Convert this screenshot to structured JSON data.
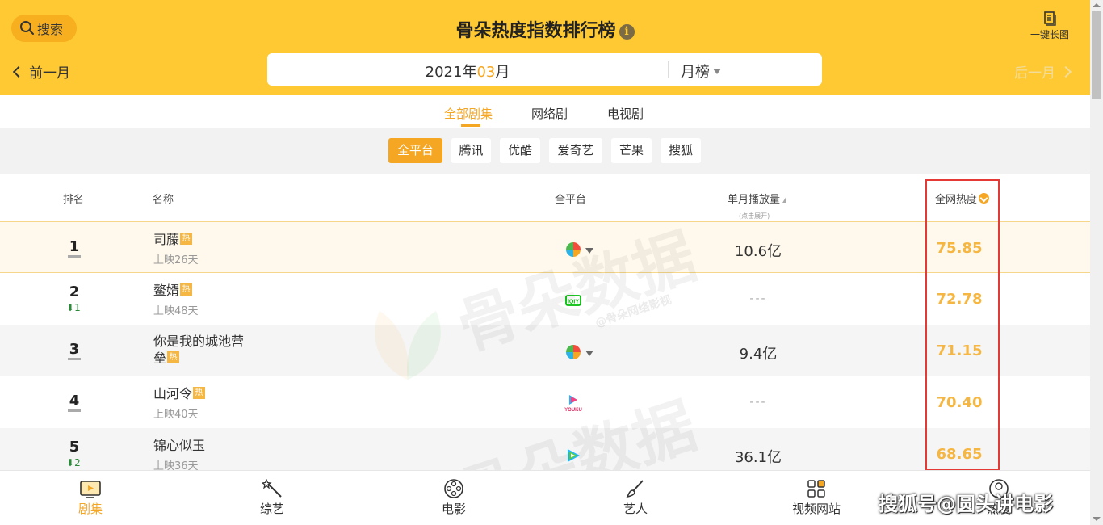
{
  "header": {
    "search_label": "搜索",
    "title": "骨朵热度指数排行榜",
    "info_icon": "i",
    "long_image_label": "一键长图",
    "prev_month_label": "前一月",
    "next_month_label": "后一月",
    "date_year": "2021年",
    "date_month": "03",
    "date_month_suffix": "月",
    "rank_type": "月榜"
  },
  "category_tabs": [
    "全部剧集",
    "网络剧",
    "电视剧"
  ],
  "platform_tabs": [
    "全平台",
    "腾讯",
    "优酷",
    "爱奇艺",
    "芒果",
    "搜狐"
  ],
  "table": {
    "columns": {
      "rank": "排名",
      "name": "名称",
      "platform": "全平台",
      "plays": "单月播放量",
      "plays_hint": "(点击展开)",
      "heat": "全网热度"
    },
    "hot_tag": "热",
    "rows": [
      {
        "rank": "1",
        "change": "",
        "name": "司藤",
        "name_line2": "",
        "sub": "上映26天",
        "platform_icon": "multi-platform-icon",
        "plays": "10.6亿",
        "heat": "75.85"
      },
      {
        "rank": "2",
        "change": "1",
        "name": "鳌婿",
        "name_line2": "",
        "sub": "上映48天",
        "platform_icon": "iqiyi-icon",
        "plays": "---",
        "heat": "72.78"
      },
      {
        "rank": "3",
        "change": "",
        "name": "你是我的城池营",
        "name_line2": "垒",
        "sub": "",
        "platform_icon": "multi-platform-icon",
        "plays": "9.4亿",
        "heat": "71.15"
      },
      {
        "rank": "4",
        "change": "",
        "name": "山河令",
        "name_line2": "",
        "sub": "上映40天",
        "platform_icon": "youku-icon",
        "plays": "---",
        "heat": "70.40"
      },
      {
        "rank": "5",
        "change": "2",
        "name": "锦心似玉",
        "name_line2": "",
        "sub": "上映36天",
        "platform_icon": "tencent-video-icon",
        "plays": "36.1亿",
        "heat": "68.65"
      }
    ]
  },
  "watermark": {
    "brand": "骨朵数据",
    "sub": "@骨朵网络影视"
  },
  "bottom_nav": [
    "剧集",
    "综艺",
    "电影",
    "艺人",
    "视频网站",
    "热度"
  ],
  "overlay_watermark": "搜狐号@圆头讲电影",
  "colors": {
    "header": "#ffc933",
    "accent": "#f5a623",
    "heat": "#f5b642",
    "highlight": "#e53935"
  }
}
